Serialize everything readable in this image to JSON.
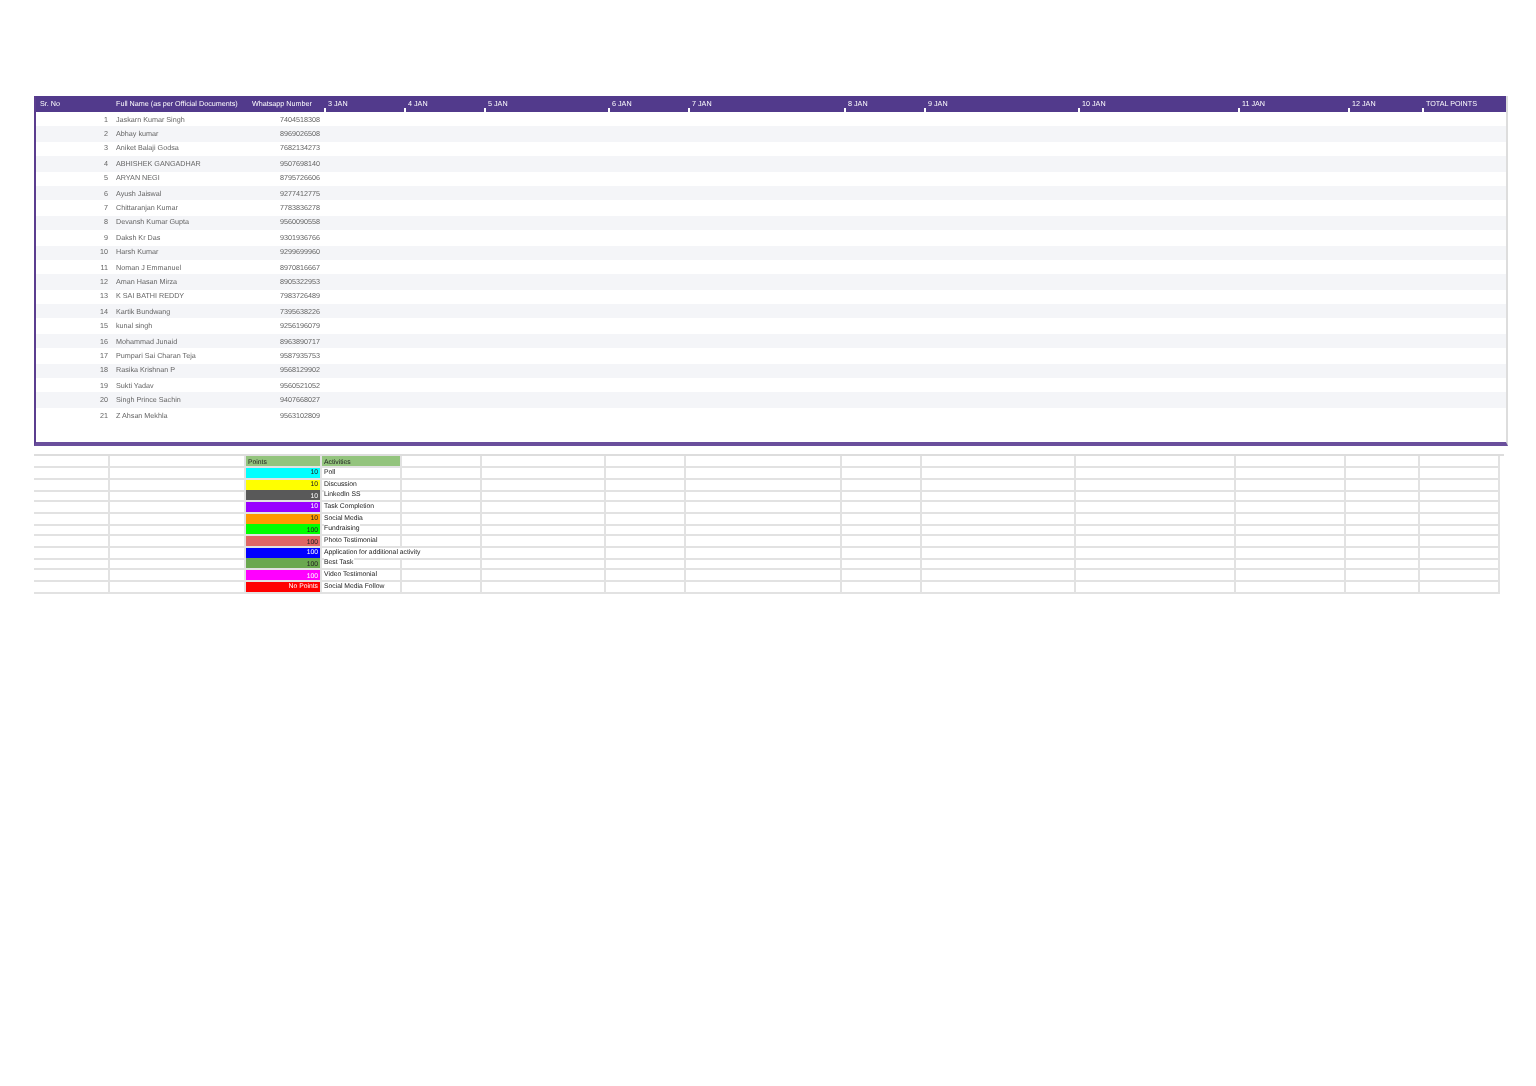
{
  "table": {
    "columns": [
      "Sr. No",
      "Full Name (as per Official Documents)",
      "Whatsapp Number",
      "3 JAN",
      "4 JAN",
      "5 JAN",
      "6 JAN",
      "7 JAN",
      "8 JAN",
      "9 JAN",
      "10 JAN",
      "11 JAN",
      "12 JAN",
      "TOTAL POINTS"
    ],
    "rows": [
      {
        "sr": "1",
        "name": "Jaskarn Kumar Singh",
        "phone": "7404518308"
      },
      {
        "sr": "2",
        "name": "Abhay kumar",
        "phone": "8969026508"
      },
      {
        "sr": "3",
        "name": "Aniket Balaji Godsa",
        "phone": "7682134273"
      },
      {
        "sr": "4",
        "name": "ABHISHEK GANGADHAR",
        "phone": "9507698140"
      },
      {
        "sr": "5",
        "name": "ARYAN NEGI",
        "phone": "8795726606"
      },
      {
        "sr": "6",
        "name": "Ayush Jaiswal",
        "phone": "9277412775"
      },
      {
        "sr": "7",
        "name": "Chittaranjan Kumar",
        "phone": "7783836278"
      },
      {
        "sr": "8",
        "name": "Devansh Kumar Gupta",
        "phone": "9560090558"
      },
      {
        "sr": "9",
        "name": "Daksh Kr Das",
        "phone": "9301936766"
      },
      {
        "sr": "10",
        "name": "Harsh Kumar",
        "phone": "9299699960"
      },
      {
        "sr": "11",
        "name": "Noman J Emmanuel",
        "phone": "8970816667"
      },
      {
        "sr": "12",
        "name": "Aman Hasan Mirza",
        "phone": "8905322953"
      },
      {
        "sr": "13",
        "name": "K SAI BATHI REDDY",
        "phone": "7983726489"
      },
      {
        "sr": "14",
        "name": "Kartik Bundwang",
        "phone": "7395638226"
      },
      {
        "sr": "15",
        "name": "kunal singh",
        "phone": "9256196079"
      },
      {
        "sr": "16",
        "name": "Mohammad Junaid",
        "phone": "8963890717"
      },
      {
        "sr": "17",
        "name": "Pumpari Sai Charan Teja",
        "phone": "9587935753"
      },
      {
        "sr": "18",
        "name": "Rasika Krishnan P",
        "phone": "9568129902"
      },
      {
        "sr": "19",
        "name": "Sukti Yadav",
        "phone": "9560521052"
      },
      {
        "sr": "20",
        "name": "Singh Prince Sachin",
        "phone": "9407668027"
      },
      {
        "sr": "21",
        "name": "Z Ahsan Mekhla",
        "phone": "9563102809"
      }
    ]
  },
  "legend": {
    "headers": [
      "Points",
      "Activities"
    ],
    "items": [
      {
        "points": "10",
        "activity": "Poll",
        "color": "#00ffff"
      },
      {
        "points": "10",
        "activity": "Discussion",
        "color": "#ffff00"
      },
      {
        "points": "10",
        "activity": "LinkedIn SS",
        "color": "#595959"
      },
      {
        "points": "10",
        "activity": "Task Completion",
        "color": "#9900ff"
      },
      {
        "points": "10",
        "activity": "Social Media",
        "color": "#ff9900"
      },
      {
        "points": "100",
        "activity": "Fundraising",
        "color": "#00ff00"
      },
      {
        "points": "100",
        "activity": "Photo Testimonial",
        "color": "#e06666"
      },
      {
        "points": "100",
        "activity": "Application for additional activity",
        "color": "#0000ff"
      },
      {
        "points": "100",
        "activity": "Best Task",
        "color": "#6aa84f"
      },
      {
        "points": "100",
        "activity": "Video Testimonial",
        "color": "#ff00ff"
      },
      {
        "points": "No Points",
        "activity": "Social Media Follow",
        "color": "#ff0000"
      }
    ]
  }
}
